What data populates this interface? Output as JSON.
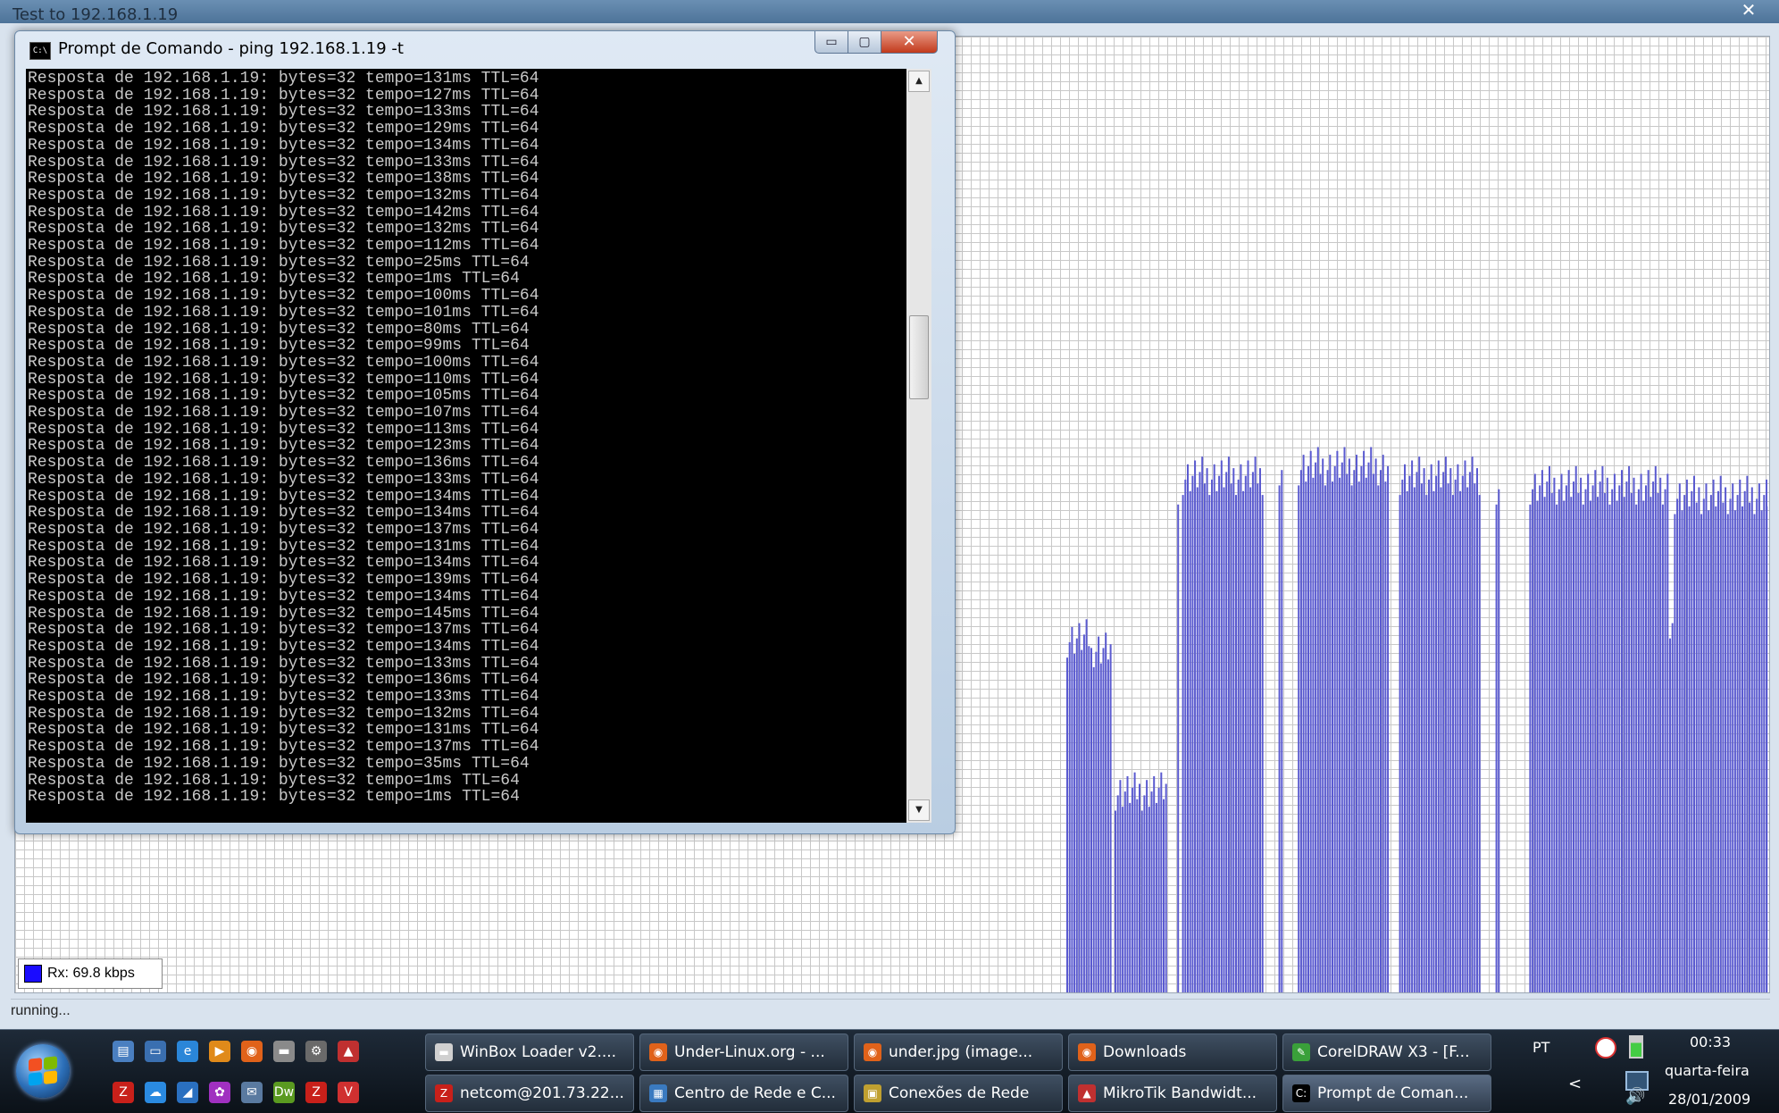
{
  "bandwidth_window": {
    "title": "Test to 192.168.1.19",
    "close_glyph": "✕",
    "legend_label": "Rx: 69.8 kbps",
    "legend_color": "#1a0cff",
    "status": "running...",
    "bar_color": "#5a5ad0"
  },
  "chart_data": {
    "type": "bar",
    "series": [
      {
        "name": "Rx: 69.8 kbps"
      }
    ],
    "level_fractions_segments": [
      {
        "count": 10,
        "level": 0.37
      },
      {
        "count": 1,
        "level": 0.38
      },
      {
        "count": 8,
        "level": 0.36
      },
      {
        "count": 1,
        "level": 0.0
      },
      {
        "count": 22,
        "level": 0.21
      },
      {
        "count": 4,
        "level": 0.0
      },
      {
        "count": 1,
        "level": 0.53
      },
      {
        "count": 1,
        "level": 0.0
      },
      {
        "count": 34,
        "level": 0.54
      },
      {
        "count": 6,
        "level": 0.0
      },
      {
        "count": 2,
        "level": 0.55
      },
      {
        "count": 6,
        "level": 0.0
      },
      {
        "count": 38,
        "level": 0.55
      },
      {
        "count": 4,
        "level": 0.0
      },
      {
        "count": 34,
        "level": 0.54
      },
      {
        "count": 6,
        "level": 0.0
      },
      {
        "count": 2,
        "level": 0.53
      },
      {
        "count": 12,
        "level": 0.0
      },
      {
        "count": 58,
        "level": 0.53
      },
      {
        "count": 2,
        "level": 0.39
      },
      {
        "count": 40,
        "level": 0.52
      }
    ]
  },
  "cmd": {
    "title": "Prompt de Comando - ping  192.168.1.19 -t",
    "icon_label": "C:\\",
    "min_glyph": "▭",
    "max_glyph": "▢",
    "close_glyph": "✕",
    "scroll_up_glyph": "▲",
    "scroll_down_glyph": "▼",
    "lines": [
      "Resposta de 192.168.1.19: bytes=32 tempo=131ms TTL=64",
      "Resposta de 192.168.1.19: bytes=32 tempo=127ms TTL=64",
      "Resposta de 192.168.1.19: bytes=32 tempo=133ms TTL=64",
      "Resposta de 192.168.1.19: bytes=32 tempo=129ms TTL=64",
      "Resposta de 192.168.1.19: bytes=32 tempo=134ms TTL=64",
      "Resposta de 192.168.1.19: bytes=32 tempo=133ms TTL=64",
      "Resposta de 192.168.1.19: bytes=32 tempo=138ms TTL=64",
      "Resposta de 192.168.1.19: bytes=32 tempo=132ms TTL=64",
      "Resposta de 192.168.1.19: bytes=32 tempo=142ms TTL=64",
      "Resposta de 192.168.1.19: bytes=32 tempo=132ms TTL=64",
      "Resposta de 192.168.1.19: bytes=32 tempo=112ms TTL=64",
      "Resposta de 192.168.1.19: bytes=32 tempo=25ms TTL=64",
      "Resposta de 192.168.1.19: bytes=32 tempo=1ms TTL=64",
      "Resposta de 192.168.1.19: bytes=32 tempo=100ms TTL=64",
      "Resposta de 192.168.1.19: bytes=32 tempo=101ms TTL=64",
      "Resposta de 192.168.1.19: bytes=32 tempo=80ms TTL=64",
      "Resposta de 192.168.1.19: bytes=32 tempo=99ms TTL=64",
      "Resposta de 192.168.1.19: bytes=32 tempo=100ms TTL=64",
      "Resposta de 192.168.1.19: bytes=32 tempo=110ms TTL=64",
      "Resposta de 192.168.1.19: bytes=32 tempo=105ms TTL=64",
      "Resposta de 192.168.1.19: bytes=32 tempo=107ms TTL=64",
      "Resposta de 192.168.1.19: bytes=32 tempo=113ms TTL=64",
      "Resposta de 192.168.1.19: bytes=32 tempo=123ms TTL=64",
      "Resposta de 192.168.1.19: bytes=32 tempo=136ms TTL=64",
      "Resposta de 192.168.1.19: bytes=32 tempo=133ms TTL=64",
      "Resposta de 192.168.1.19: bytes=32 tempo=134ms TTL=64",
      "Resposta de 192.168.1.19: bytes=32 tempo=134ms TTL=64",
      "Resposta de 192.168.1.19: bytes=32 tempo=137ms TTL=64",
      "Resposta de 192.168.1.19: bytes=32 tempo=131ms TTL=64",
      "Resposta de 192.168.1.19: bytes=32 tempo=134ms TTL=64",
      "Resposta de 192.168.1.19: bytes=32 tempo=139ms TTL=64",
      "Resposta de 192.168.1.19: bytes=32 tempo=134ms TTL=64",
      "Resposta de 192.168.1.19: bytes=32 tempo=145ms TTL=64",
      "Resposta de 192.168.1.19: bytes=32 tempo=137ms TTL=64",
      "Resposta de 192.168.1.19: bytes=32 tempo=134ms TTL=64",
      "Resposta de 192.168.1.19: bytes=32 tempo=133ms TTL=64",
      "Resposta de 192.168.1.19: bytes=32 tempo=136ms TTL=64",
      "Resposta de 192.168.1.19: bytes=32 tempo=133ms TTL=64",
      "Resposta de 192.168.1.19: bytes=32 tempo=132ms TTL=64",
      "Resposta de 192.168.1.19: bytes=32 tempo=131ms TTL=64",
      "Resposta de 192.168.1.19: bytes=32 tempo=137ms TTL=64",
      "Resposta de 192.168.1.19: bytes=32 tempo=35ms TTL=64",
      "Resposta de 192.168.1.19: bytes=32 tempo=1ms TTL=64",
      "Resposta de 192.168.1.19: bytes=32 tempo=1ms TTL=64"
    ]
  },
  "taskbar": {
    "quick_launch": [
      {
        "icon": "show-desktop-icon",
        "glyph": "▤",
        "color": "#4a7fc0"
      },
      {
        "icon": "monitor-icon",
        "glyph": "▭",
        "color": "#3a6fb0"
      },
      {
        "icon": "internet-explorer-icon",
        "glyph": "e",
        "color": "#2a86d8"
      },
      {
        "icon": "media-player-icon",
        "glyph": "▶",
        "color": "#e08a1a"
      },
      {
        "icon": "firefox-icon",
        "glyph": "◉",
        "color": "#e0621a"
      },
      {
        "icon": "window-icon",
        "glyph": "▬",
        "color": "#8a8a8a"
      },
      {
        "icon": "network-icon",
        "glyph": "⚙",
        "color": "#6a6a6a"
      },
      {
        "icon": "mikrotik-icon",
        "glyph": "▲",
        "color": "#c03030"
      },
      {
        "icon": "filezilla-icon",
        "glyph": "Z",
        "color": "#c8201a"
      },
      {
        "icon": "cloud-icon",
        "glyph": "☁",
        "color": "#2a8ae0"
      },
      {
        "icon": "chart-icon",
        "glyph": "◢",
        "color": "#2a70c0"
      },
      {
        "icon": "orb-icon",
        "glyph": "✿",
        "color": "#a030c0"
      },
      {
        "icon": "mail-icon",
        "glyph": "✉",
        "color": "#5a7aa0"
      },
      {
        "icon": "dreamweaver-icon",
        "glyph": "Dw",
        "color": "#5a9a20"
      },
      {
        "icon": "filezilla-icon",
        "glyph": "Z",
        "color": "#c8201a"
      },
      {
        "icon": "vnc-icon",
        "glyph": "V",
        "color": "#d03030"
      }
    ],
    "tasks": [
      {
        "label": "WinBox Loader v2....",
        "icon": "winbox-icon",
        "glyph": "▬",
        "color": "#d0d0d0"
      },
      {
        "label": "Under-Linux.org - ...",
        "icon": "firefox-icon",
        "glyph": "◉",
        "color": "#e0621a"
      },
      {
        "label": "under.jpg (image...",
        "icon": "firefox-icon",
        "glyph": "◉",
        "color": "#e0621a"
      },
      {
        "label": "Downloads",
        "icon": "firefox-icon",
        "glyph": "◉",
        "color": "#e0621a"
      },
      {
        "label": "CorelDRAW X3 - [F...",
        "icon": "coreldraw-icon",
        "glyph": "✎",
        "color": "#3aa03a"
      },
      {
        "label": "netcom@201.73.22...",
        "icon": "filezilla-icon",
        "glyph": "Z",
        "color": "#c8201a"
      },
      {
        "label": "Centro de Rede e C...",
        "icon": "network-center-icon",
        "glyph": "▦",
        "color": "#3a7ac0"
      },
      {
        "label": "Conexões de Rede",
        "icon": "network-connections-icon",
        "glyph": "▣",
        "color": "#c0a030"
      },
      {
        "label": "MikroTik Bandwidt...",
        "icon": "mikrotik-icon",
        "glyph": "▲",
        "color": "#c03030"
      },
      {
        "label": "Prompt de Coman...",
        "icon": "cmd-icon",
        "glyph": "C:",
        "color": "#000000"
      }
    ],
    "tray": {
      "language": "PT",
      "time": "00:33",
      "weekday": "quarta-feira",
      "date": "28/01/2009",
      "chevron": "<"
    }
  }
}
